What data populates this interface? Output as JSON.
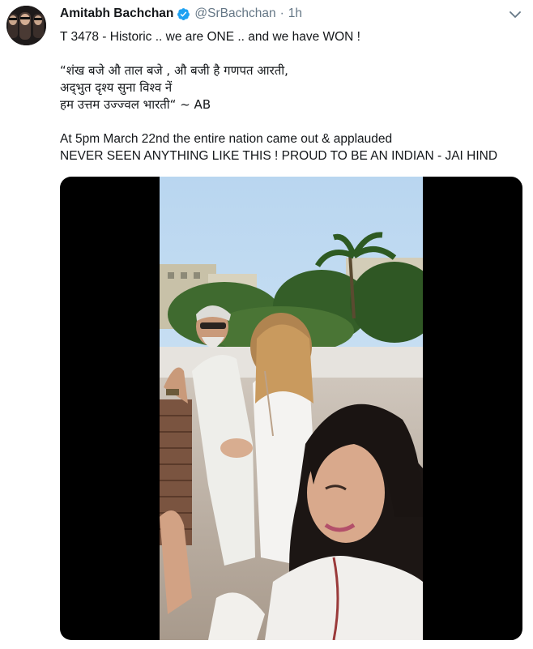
{
  "tweet": {
    "author_name": "Amitabh Bachchan",
    "handle": "@SrBachchan",
    "separator": "·",
    "time": "1h",
    "lines": {
      "line1": "T 3478 - Historic .. we are ONE .. and we have WON !",
      "line2": "“शंख बजे औ ताल बजे , औ बजी है गणपत आरती,",
      "line3": "अद्‌भुत दृश्य सुना विश्व नें",
      "line4": "हम उत्तम उज्ज्वल भारती“ ~ AB",
      "line5": "At 5pm March 22nd the entire nation came out & applauded",
      "line6": "NEVER SEEN ANYTHING LIKE THIS ! PROUD TO BE AN INDIAN - JAI HIND"
    }
  },
  "icons": {
    "verified": "verified-badge-icon",
    "menu": "chevron-down-icon"
  },
  "colors": {
    "text": "#14171a",
    "muted": "#657786",
    "verified": "#1da1f2",
    "media_background": "#000000"
  }
}
